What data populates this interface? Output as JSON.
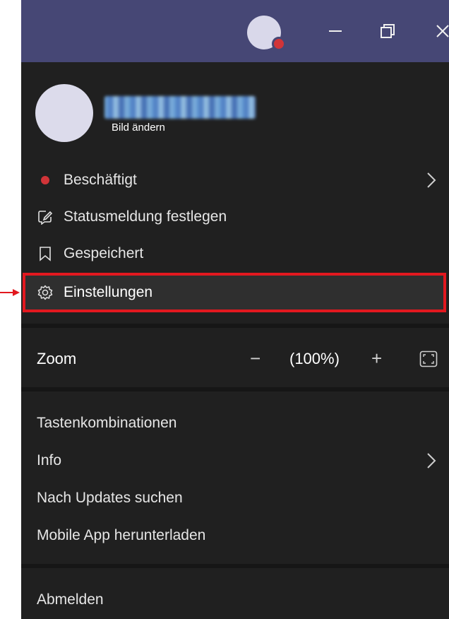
{
  "titlebar": {
    "avatar_status_color": "#d13438",
    "minimize_icon": "minimize-icon",
    "restore_icon": "restore-icon",
    "close_icon": "close-icon"
  },
  "profile": {
    "change_picture_label": "Bild ändern"
  },
  "menu": {
    "status": {
      "label": "Beschäftigt",
      "status_color": "#d13438"
    },
    "status_message": {
      "label": "Statusmeldung festlegen"
    },
    "saved": {
      "label": "Gespeichert"
    },
    "settings": {
      "label": "Einstellungen",
      "highlight_color": "#e2181f"
    }
  },
  "zoom": {
    "label": "Zoom",
    "minus": "−",
    "value": "(100%)",
    "plus": "+"
  },
  "links": {
    "shortcuts": "Tastenkombinationen",
    "info": "Info",
    "updates": "Nach Updates suchen",
    "mobile_app": "Mobile App herunterladen"
  },
  "logout": {
    "label": "Abmelden"
  },
  "colors": {
    "titlebar_bg": "#464775",
    "menu_bg": "#202020",
    "accent_red": "#e2181f"
  }
}
